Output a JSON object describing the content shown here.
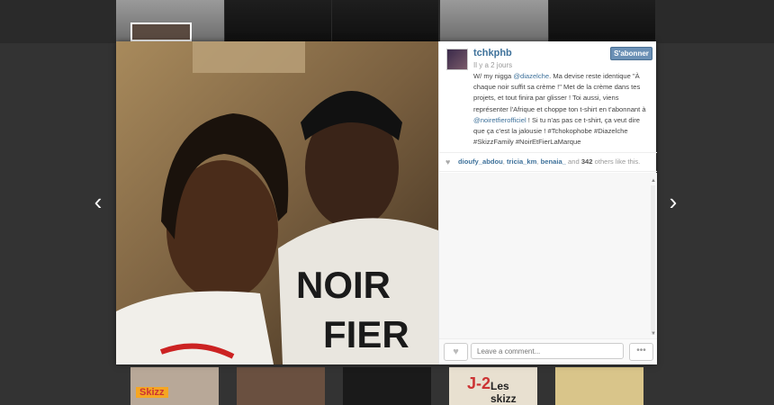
{
  "post": {
    "username": "tchkphb",
    "follow_label": "S'abonner",
    "time_ago": "Il y a 2 jours",
    "caption": {
      "p1": "W/ my nigga ",
      "mention1": "@diazelche",
      "p2": ". Ma devise reste identique \"À chaque noir suffit sa crème !\" Met de la crème dans tes projets, et tout finira par glisser ! Toi aussi, viens représenter l'Afrique et choppe ton t-shirt en t'abonnant à ",
      "mention2": "@noiretfierofficiel",
      "p3": " ! Si tu n'as pas ce t-shirt, ça veut dire que ça c'est la jalousie ! #Tchokophobe #Diazelche #SkizzFamily #NoirEtFierLaMarque"
    },
    "likes": {
      "user1": "dioufy_abdou",
      "user2": "tricia_km",
      "user3": "benaia_",
      "and_text": "and",
      "count": "342",
      "suffix": "others like this."
    },
    "comment_placeholder": "Leave a comment...",
    "more_label": "•••"
  },
  "nav": {
    "prev": "‹",
    "next": "›"
  },
  "photo": {
    "shirt_text_1": "NOIR",
    "shirt_text_2": "FIER"
  },
  "thumbs": {
    "t1": "Skizz",
    "t2": "J-2",
    "t3": "Les skizz"
  },
  "icons": {
    "heart": "heart-icon",
    "more": "more-options-icon"
  }
}
